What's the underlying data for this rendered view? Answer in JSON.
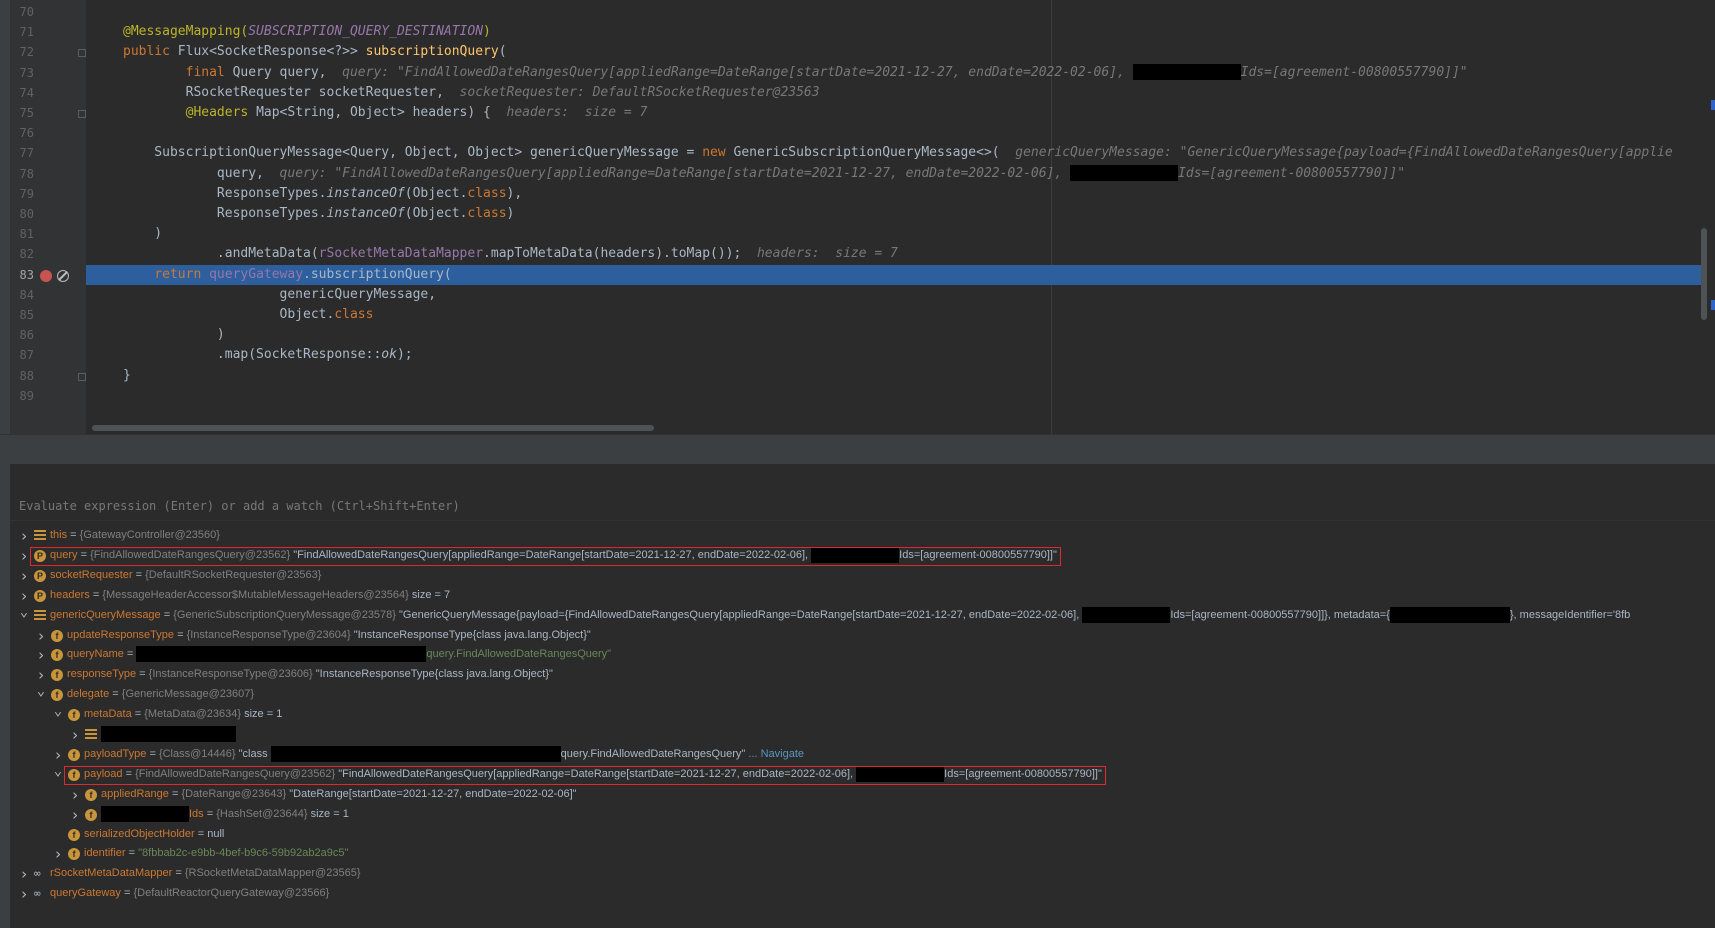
{
  "editor": {
    "lines": [
      {
        "num": "70",
        "segments": []
      },
      {
        "num": "71",
        "segments": [
          {
            "t": "@MessageMapping(",
            "c": "ann"
          },
          {
            "t": "SUBSCRIPTION_QUERY_DESTINATION",
            "c": "cn"
          },
          {
            "t": ")",
            "c": "ann"
          }
        ]
      },
      {
        "num": "72",
        "segments": [
          {
            "t": "public ",
            "c": "kw"
          },
          {
            "t": "Flux<SocketResponse<?>> "
          },
          {
            "t": "subscriptionQuery",
            "c": "fn"
          },
          {
            "t": "("
          }
        ]
      },
      {
        "num": "73",
        "segments": [
          {
            "t": "        final ",
            "c": "kw"
          },
          {
            "t": "Query query,  "
          },
          {
            "t": "query: \"FindAllowedDateRangesQuery[appliedRange=DateRange[startDate=2021-12-27, endDate=2022-02-06], ",
            "c": "hint"
          },
          {
            "redact": 108
          },
          {
            "t": "Ids=[agreement-00800557790]]\"",
            "c": "hint"
          }
        ]
      },
      {
        "num": "74",
        "segments": [
          {
            "t": "        RSocketRequester socketRequester,  "
          },
          {
            "t": "socketRequester: DefaultRSocketRequester@23563",
            "c": "hint"
          }
        ]
      },
      {
        "num": "75",
        "segments": [
          {
            "t": "        @Headers ",
            "c": "ann"
          },
          {
            "t": "Map<String, Object> headers) {  "
          },
          {
            "t": "headers:  size = 7",
            "c": "hint"
          }
        ]
      },
      {
        "num": "76",
        "segments": []
      },
      {
        "num": "77",
        "segments": [
          {
            "t": "    SubscriptionQueryMessage<Query, Object, Object> genericQueryMessage = "
          },
          {
            "t": "new ",
            "c": "kw"
          },
          {
            "t": "GenericSubscriptionQueryMessage<>(  "
          },
          {
            "t": "genericQueryMessage: \"GenericQueryMessage{payload={FindAllowedDateRangesQuery[applie",
            "c": "hint"
          }
        ]
      },
      {
        "num": "78",
        "segments": [
          {
            "t": "            query,  "
          },
          {
            "t": "query: \"FindAllowedDateRangesQuery[appliedRange=DateRange[startDate=2021-12-27, endDate=2022-02-06], ",
            "c": "hint"
          },
          {
            "redact": 108
          },
          {
            "t": "Ids=[agreement-00800557790]]\"",
            "c": "hint"
          }
        ]
      },
      {
        "num": "79",
        "segments": [
          {
            "t": "            ResponseTypes."
          },
          {
            "t": "instanceOf",
            "c": "ital"
          },
          {
            "t": "(Object."
          },
          {
            "t": "class",
            "c": "kw"
          },
          {
            "t": "),"
          }
        ]
      },
      {
        "num": "80",
        "segments": [
          {
            "t": "            ResponseTypes."
          },
          {
            "t": "instanceOf",
            "c": "ital"
          },
          {
            "t": "(Object."
          },
          {
            "t": "class",
            "c": "kw"
          },
          {
            "t": ")"
          }
        ]
      },
      {
        "num": "81",
        "segments": [
          {
            "t": "    )"
          }
        ]
      },
      {
        "num": "82",
        "segments": [
          {
            "t": "            .andMetaData("
          },
          {
            "t": "rSocketMetaDataMapper",
            "c": "fld"
          },
          {
            "t": ".mapToMetaData(headers).toMap());  "
          },
          {
            "t": "headers:  size = 7",
            "c": "hint"
          }
        ]
      },
      {
        "num": "83",
        "segments": [
          {
            "t": "    "
          },
          {
            "t": "return ",
            "c": "kw"
          },
          {
            "t": "queryGateway",
            "c": "fld"
          },
          {
            "t": ".subscriptionQuery("
          }
        ]
      },
      {
        "num": "84",
        "segments": [
          {
            "t": "                    genericQueryMessage,"
          }
        ]
      },
      {
        "num": "85",
        "segments": [
          {
            "t": "                    Object."
          },
          {
            "t": "class",
            "c": "kw"
          }
        ]
      },
      {
        "num": "86",
        "segments": [
          {
            "t": "            )"
          }
        ]
      },
      {
        "num": "87",
        "segments": [
          {
            "t": "            .map(SocketResponse::"
          },
          {
            "t": "ok",
            "c": "ital"
          },
          {
            "t": ");"
          }
        ]
      },
      {
        "num": "88",
        "segments": [
          {
            "t": "}"
          }
        ]
      },
      {
        "num": "89",
        "segments": []
      }
    ],
    "highlighted_line": "83"
  },
  "debugger": {
    "eval_placeholder": "Evaluate expression (Enter) or add a watch (Ctrl+Shift+Enter)",
    "variables": [
      {
        "indent": 0,
        "chev": ">",
        "icon": "list",
        "segments": [
          {
            "t": "this",
            "c": "vname"
          },
          {
            "t": " = "
          },
          {
            "t": "{GatewayController@23560}",
            "c": "vtype"
          }
        ]
      },
      {
        "indent": 0,
        "chev": ">",
        "icon": "P",
        "segments": [
          {
            "t": "query",
            "c": "vname"
          },
          {
            "t": " = "
          },
          {
            "t": "{FindAllowedDateRangesQuery@23562} ",
            "c": "vtype"
          },
          {
            "t": "\"FindAllowedDateRangesQuery[appliedRange=DateRange[startDate=2021-12-27, endDate=2022-02-06], "
          },
          {
            "redact": 88
          },
          {
            "t": "Ids=[agreement-00800557790]]\""
          }
        ]
      },
      {
        "indent": 0,
        "chev": ">",
        "icon": "P",
        "segments": [
          {
            "t": "socketRequester",
            "c": "vname"
          },
          {
            "t": " = "
          },
          {
            "t": "{DefaultRSocketRequester@23563}",
            "c": "vtype"
          }
        ]
      },
      {
        "indent": 0,
        "chev": ">",
        "icon": "P",
        "segments": [
          {
            "t": "headers",
            "c": "vname"
          },
          {
            "t": " = "
          },
          {
            "t": "{MessageHeaderAccessor$MutableMessageHeaders@23564} ",
            "c": "vtype"
          },
          {
            "t": " size = 7"
          }
        ]
      },
      {
        "indent": 0,
        "chev": "v",
        "icon": "list",
        "segments": [
          {
            "t": "genericQueryMessage",
            "c": "vname"
          },
          {
            "t": " = "
          },
          {
            "t": "{GenericSubscriptionQueryMessage@23578} ",
            "c": "vtype"
          },
          {
            "t": "\"GenericQueryMessage{payload={FindAllowedDateRangesQuery[appliedRange=DateRange[startDate=2021-12-27, endDate=2022-02-06], "
          },
          {
            "redact": 88
          },
          {
            "t": "Ids=[agreement-00800557790]]}, metadata={"
          },
          {
            "redact": 120
          },
          {
            "t": "}, messageIdentifier='8fb"
          }
        ]
      },
      {
        "indent": 1,
        "chev": ">",
        "icon": "f",
        "segments": [
          {
            "t": "updateResponseType",
            "c": "vname"
          },
          {
            "t": " = "
          },
          {
            "t": "{InstanceResponseType@23604} ",
            "c": "vtype"
          },
          {
            "t": "\"InstanceResponseType{class java.lang.Object}\""
          }
        ]
      },
      {
        "indent": 1,
        "chev": ">",
        "icon": "f",
        "segments": [
          {
            "t": "queryName",
            "c": "vname"
          },
          {
            "t": " = "
          },
          {
            "redact": 290
          },
          {
            "t": "query.FindAllowedDateRangesQuery\"",
            "c": "vstr"
          }
        ]
      },
      {
        "indent": 1,
        "chev": ">",
        "icon": "f",
        "segments": [
          {
            "t": "responseType",
            "c": "vname"
          },
          {
            "t": " = "
          },
          {
            "t": "{InstanceResponseType@23606} ",
            "c": "vtype"
          },
          {
            "t": "\"InstanceResponseType{class java.lang.Object}\""
          }
        ]
      },
      {
        "indent": 1,
        "chev": "v",
        "icon": "f",
        "segments": [
          {
            "t": "delegate",
            "c": "vname"
          },
          {
            "t": " = "
          },
          {
            "t": "{GenericMessage@23607}",
            "c": "vtype"
          }
        ]
      },
      {
        "indent": 2,
        "chev": "v",
        "icon": "f",
        "segments": [
          {
            "t": "metaData",
            "c": "vname"
          },
          {
            "t": " = "
          },
          {
            "t": "{MetaData@23634} ",
            "c": "vtype"
          },
          {
            "t": " size = 1"
          }
        ]
      },
      {
        "indent": 3,
        "chev": ">",
        "icon": "list",
        "segments": [
          {
            "redact": 135
          }
        ]
      },
      {
        "indent": 2,
        "chev": ">",
        "icon": "f",
        "segments": [
          {
            "t": "payloadType",
            "c": "vname"
          },
          {
            "t": " = "
          },
          {
            "t": "{Class@14446} ",
            "c": "vtype"
          },
          {
            "t": "\"class "
          },
          {
            "redact": 290
          },
          {
            "t": "query.FindAllowedDateRangesQuery\""
          },
          {
            "t": " ... Navigate",
            "c": "vlink"
          }
        ]
      },
      {
        "indent": 2,
        "chev": "v",
        "icon": "f",
        "segments": [
          {
            "t": "payload",
            "c": "vname"
          },
          {
            "t": " = "
          },
          {
            "t": "{FindAllowedDateRangesQuery@23562} ",
            "c": "vtype"
          },
          {
            "t": "\"FindAllowedDateRangesQuery[appliedRange=DateRange[startDate=2021-12-27, endDate=2022-02-06], "
          },
          {
            "redact": 88
          },
          {
            "t": "Ids=[agreement-00800557790]]\""
          }
        ]
      },
      {
        "indent": 3,
        "chev": ">",
        "icon": "f",
        "segments": [
          {
            "t": "appliedRange",
            "c": "vname"
          },
          {
            "t": " = "
          },
          {
            "t": "{DateRange@23643} ",
            "c": "vtype"
          },
          {
            "t": "\"DateRange[startDate=2021-12-27, endDate=2022-02-06]\""
          }
        ]
      },
      {
        "indent": 3,
        "chev": ">",
        "icon": "f",
        "segments": [
          {
            "redact": 88
          },
          {
            "t": "Ids",
            "c": "vname"
          },
          {
            "t": " = "
          },
          {
            "t": "{HashSet@23644} ",
            "c": "vtype"
          },
          {
            "t": " size = 1"
          }
        ]
      },
      {
        "indent": 2,
        "chev": "",
        "icon": "f",
        "segments": [
          {
            "t": "serializedObjectHolder",
            "c": "vname"
          },
          {
            "t": " = null"
          }
        ]
      },
      {
        "indent": 2,
        "chev": ">",
        "icon": "f",
        "segments": [
          {
            "t": "identifier",
            "c": "vname"
          },
          {
            "t": " = "
          },
          {
            "t": "\"8fbbab2c-e9bb-4bef-b9c6-59b92ab2a9c5\"",
            "c": "vstr"
          }
        ]
      },
      {
        "indent": 0,
        "chev": ">",
        "icon": "glass",
        "segments": [
          {
            "t": "rSocketMetaDataMapper",
            "c": "vname"
          },
          {
            "t": " = "
          },
          {
            "t": "{RSocketMetaDataMapper@23565}",
            "c": "vtype"
          }
        ]
      },
      {
        "indent": 0,
        "chev": ">",
        "icon": "glass",
        "segments": [
          {
            "t": "queryGateway",
            "c": "vname"
          },
          {
            "t": " = "
          },
          {
            "t": "{DefaultReactorQueryGateway@23566}",
            "c": "vtype"
          }
        ]
      }
    ],
    "highlight_boxes": [
      1,
      12
    ]
  },
  "colors": {
    "highlight": "#2d5f9e",
    "box": "#e0282f",
    "background": "#2b2b2b"
  }
}
